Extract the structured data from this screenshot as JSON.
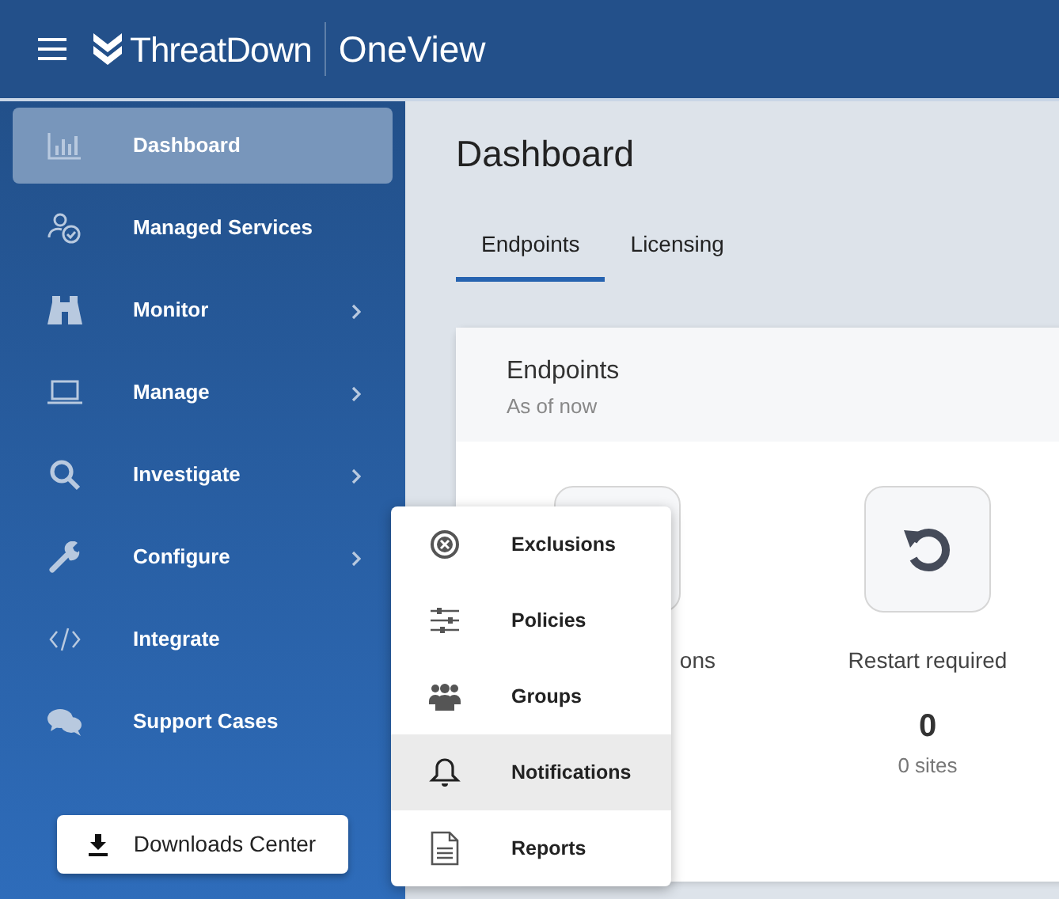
{
  "header": {
    "brand": "ThreatDown",
    "product": "OneView"
  },
  "sidebar": {
    "items": [
      {
        "label": "Dashboard",
        "kind": "chart",
        "selected": true,
        "has_submenu": false
      },
      {
        "label": "Managed Services",
        "kind": "person-check",
        "selected": false,
        "has_submenu": false
      },
      {
        "label": "Monitor",
        "kind": "binoculars",
        "selected": false,
        "has_submenu": true
      },
      {
        "label": "Manage",
        "kind": "laptop",
        "selected": false,
        "has_submenu": true
      },
      {
        "label": "Investigate",
        "kind": "search",
        "selected": false,
        "has_submenu": true
      },
      {
        "label": "Configure",
        "kind": "wrench",
        "selected": false,
        "has_submenu": true
      },
      {
        "label": "Integrate",
        "kind": "code",
        "selected": false,
        "has_submenu": false
      },
      {
        "label": "Support Cases",
        "kind": "chat",
        "selected": false,
        "has_submenu": false
      }
    ],
    "button": "Downloads Center"
  },
  "page": {
    "title": "Dashboard",
    "tabs": [
      {
        "label": "Endpoints",
        "selected": true
      },
      {
        "label": "Licensing",
        "selected": false
      }
    ],
    "card": {
      "title": "Endpoints",
      "subtitle": "As of now",
      "stats": [
        {
          "label": "ons",
          "kind": "covered"
        },
        {
          "label": "Restart required",
          "kind": "restart",
          "value": "0",
          "sub": "0 sites"
        }
      ]
    }
  },
  "submenu": {
    "items": [
      {
        "label": "Exclusions",
        "kind": "exclusion",
        "selected": false
      },
      {
        "label": "Policies",
        "kind": "sliders",
        "selected": false
      },
      {
        "label": "Groups",
        "kind": "group",
        "selected": false
      },
      {
        "label": "Notifications",
        "kind": "bell",
        "selected": true
      },
      {
        "label": "Reports",
        "kind": "document",
        "selected": false
      }
    ]
  }
}
